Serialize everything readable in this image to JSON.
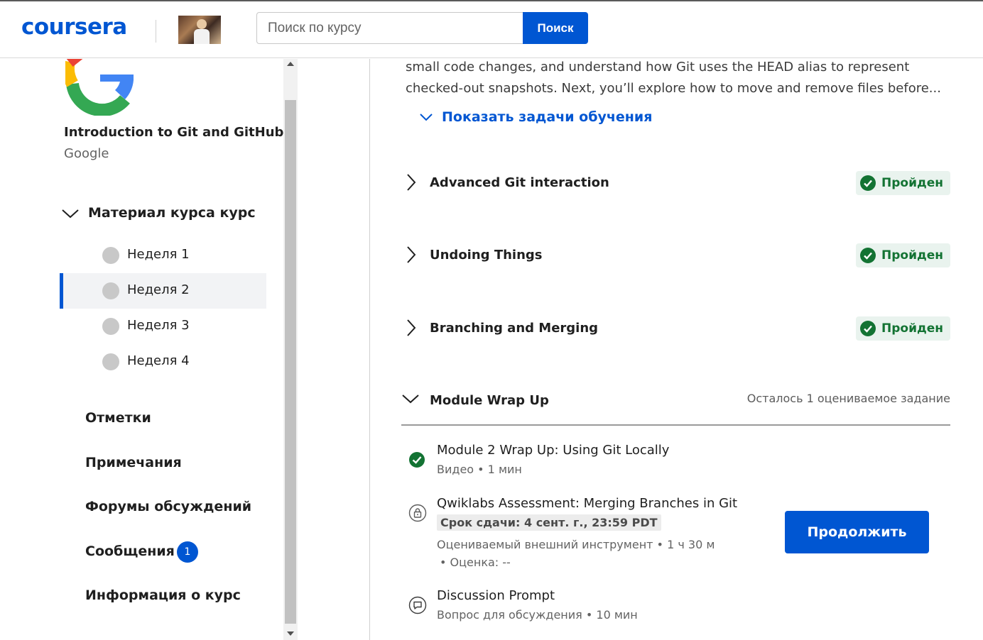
{
  "header": {
    "logo": "coursera",
    "search_placeholder": "Поиск по курсу",
    "search_button": "Поиск"
  },
  "sidebar": {
    "course_title": "Introduction to Git and GitHub",
    "partner": "Google",
    "material_label": "Материал курса курс",
    "weeks": [
      {
        "label": "Неделя 1",
        "active": false
      },
      {
        "label": "Неделя 2",
        "active": true
      },
      {
        "label": "Неделя 3",
        "active": false
      },
      {
        "label": "Неделя 4",
        "active": false
      }
    ],
    "nav": {
      "grades": "Отметки",
      "notes": "Примечания",
      "forums": "Форумы обсуждений",
      "messages": "Сообщения",
      "messages_count": "1",
      "info": "Информация о курс"
    }
  },
  "main": {
    "description": "small code changes, and understand how Git uses the HEAD alias to represent checked-out snapshots. Next, you’ll explore how to move and remove files before...",
    "show_objectives": "Показать задачи обучения",
    "modules": [
      {
        "title": "Advanced Git interaction",
        "status": "Пройден"
      },
      {
        "title": "Undoing Things",
        "status": "Пройден"
      },
      {
        "title": "Branching and Merging",
        "status": "Пройден"
      }
    ],
    "wrap_up": {
      "title": "Module Wrap Up",
      "remaining": "Осталось 1 оцениваемое задание",
      "items": [
        {
          "name": "Module 2 Wrap Up: Using Git Locally",
          "meta": "Видео • 1 мин"
        },
        {
          "name": "Qwiklabs Assessment: Merging Branches in Git",
          "deadline": "Срок сдачи: 4 сент. г., 23:59 PDT",
          "meta": "Оцениваемый внешний инструмент • 1 ч 30 м",
          "meta2": "• Оценка: --"
        },
        {
          "name": "Discussion Prompt",
          "meta": "Вопрос для обсуждения • 10 мин"
        }
      ]
    },
    "continue_button": "Продолжить"
  },
  "colors": {
    "brand": "#0056d2",
    "passed_green": "#137333",
    "passed_bg": "#e9f3ee"
  }
}
